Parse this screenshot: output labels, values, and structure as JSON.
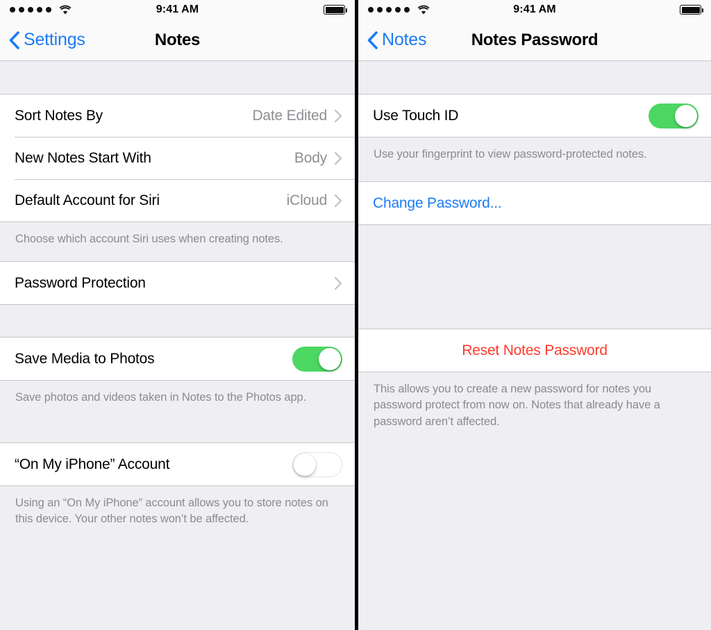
{
  "colors": {
    "accent_blue": "#1b7bf7",
    "destructive_red": "#fc3b2d",
    "toggle_on_green": "#4cd763",
    "group_background": "#eeeef3",
    "row_background": "#ffffff",
    "secondary_text": "#8e8e93"
  },
  "left_screen": {
    "status_bar": {
      "signal_strength_dots": 5,
      "wifi": "wifi-icon",
      "time": "9:41 AM",
      "battery": "battery-full-icon"
    },
    "nav": {
      "back_label": "Settings",
      "title": "Notes"
    },
    "sections": [
      {
        "rows": [
          {
            "label": "Sort Notes By",
            "value": "Date Edited",
            "accessory": "disclosure"
          },
          {
            "label": "New Notes Start With",
            "value": "Body",
            "accessory": "disclosure"
          },
          {
            "label": "Default Account for Siri",
            "value": "iCloud",
            "accessory": "disclosure"
          }
        ],
        "footer": "Choose which account Siri uses when creating notes."
      },
      {
        "rows": [
          {
            "label": "Password Protection",
            "value": "",
            "accessory": "disclosure"
          }
        ],
        "footer": ""
      },
      {
        "rows": [
          {
            "label": "Save Media to Photos",
            "value": "",
            "accessory": "toggle-on"
          }
        ],
        "footer": "Save photos and videos taken in Notes to the Photos app."
      },
      {
        "rows": [
          {
            "label": "“On My iPhone” Account",
            "value": "",
            "accessory": "toggle-off"
          }
        ],
        "footer": "Using an “On My iPhone” account allows you to store notes on this device. Your other notes won’t be affected."
      }
    ]
  },
  "right_screen": {
    "status_bar": {
      "signal_strength_dots": 5,
      "wifi": "wifi-icon",
      "time": "9:41 AM",
      "battery": "battery-full-icon"
    },
    "nav": {
      "back_label": "Notes",
      "title": "Notes Password"
    },
    "sections": [
      {
        "rows": [
          {
            "label": "Use Touch ID",
            "value": "",
            "accessory": "toggle-on"
          }
        ],
        "footer": "Use your fingerprint to view password-protected notes."
      },
      {
        "rows": [
          {
            "label": "Change Password...",
            "value": "",
            "accessory": "link"
          }
        ],
        "footer": ""
      },
      {
        "rows": [
          {
            "label": "Reset Notes Password",
            "value": "",
            "accessory": "destructive"
          }
        ],
        "footer": "This allows you to create a new password for notes you password protect from now on. Notes that already have a password aren’t affected."
      }
    ]
  }
}
